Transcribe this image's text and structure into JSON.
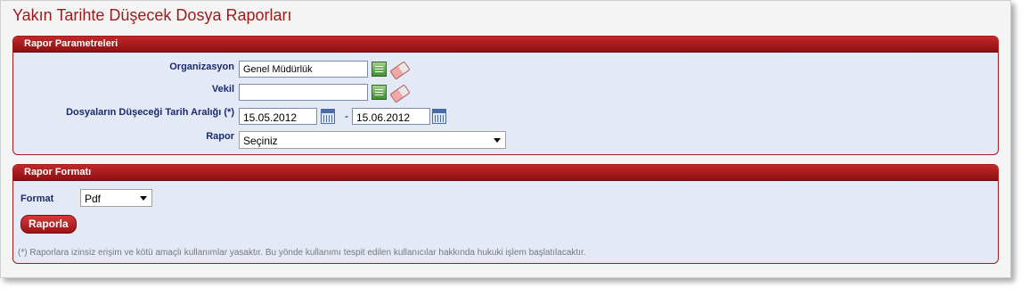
{
  "page_title": "Yakın Tarihte Düşecek Dosya Raporları",
  "params_panel": {
    "title": "Rapor Parametreleri",
    "organization_label": "Organizasyon",
    "organization_value": "Genel Müdürlük",
    "proxy_label": "Vekil",
    "proxy_value": "",
    "date_range_label": "Dosyaların Düşeceği Tarih Aralığı (*)",
    "date_from": "15.05.2012",
    "date_separator": "-",
    "date_to": "15.06.2012",
    "report_label": "Rapor",
    "report_selected": "Seçiniz"
  },
  "format_panel": {
    "title": "Rapor Formatı",
    "format_label": "Format",
    "format_selected": "Pdf",
    "report_button": "Raporla",
    "note": "(*) Raporlara izinsiz erişim ve kötü amaçlı kullanımlar yasaktır. Bu yönde kullanımı tespit edilen kullanıcılar hakkında hukuki işlem başlatılacaktır."
  },
  "icons": {
    "list": "list-icon",
    "eraser": "eraser-icon",
    "calendar": "calendar-icon"
  },
  "colors": {
    "title_red": "#9b1b1b",
    "panel_header": "#a11b1b",
    "panel_bg": "#e3e9f5",
    "label_blue": "#1a2a6c"
  }
}
